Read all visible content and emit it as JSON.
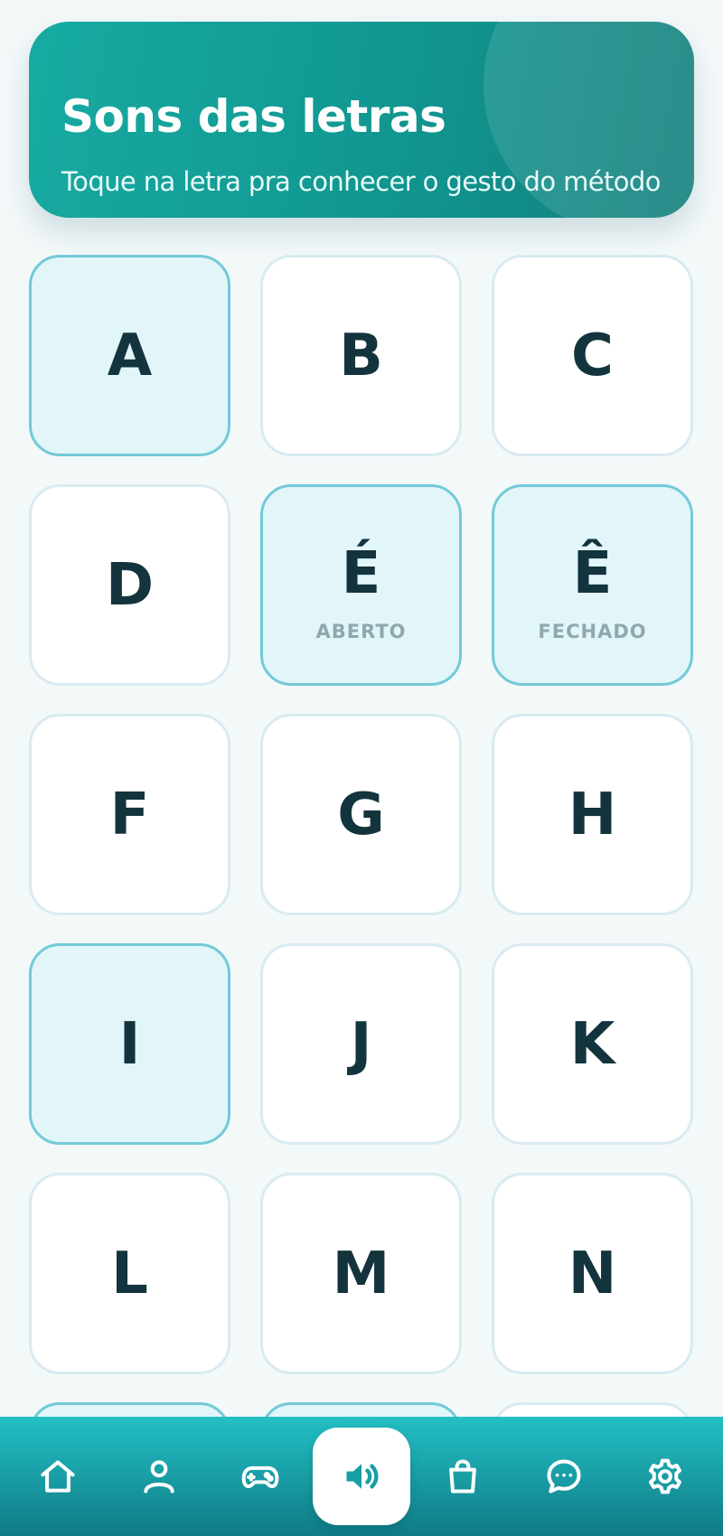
{
  "header": {
    "title": "Sons das letras",
    "subtitle": "Toque na letra pra conhecer o gesto do método"
  },
  "letters": [
    {
      "letter": "A",
      "highlighted": true
    },
    {
      "letter": "B",
      "highlighted": false
    },
    {
      "letter": "C",
      "highlighted": false
    },
    {
      "letter": "D",
      "highlighted": false
    },
    {
      "letter": "É",
      "sub": "ABERTO",
      "highlighted": true
    },
    {
      "letter": "Ê",
      "sub": "FECHADO",
      "highlighted": true
    },
    {
      "letter": "F",
      "highlighted": false
    },
    {
      "letter": "G",
      "highlighted": false
    },
    {
      "letter": "H",
      "highlighted": false
    },
    {
      "letter": "I",
      "highlighted": true
    },
    {
      "letter": "J",
      "highlighted": false
    },
    {
      "letter": "K",
      "highlighted": false
    },
    {
      "letter": "L",
      "highlighted": false
    },
    {
      "letter": "M",
      "highlighted": false
    },
    {
      "letter": "N",
      "highlighted": false
    },
    {
      "letter": "",
      "highlighted": true
    },
    {
      "letter": "",
      "highlighted": true
    },
    {
      "letter": "",
      "highlighted": false
    }
  ],
  "nav": {
    "active": "sounds",
    "items": [
      {
        "icon": "home-icon"
      },
      {
        "icon": "user-icon"
      },
      {
        "icon": "gamepad-icon"
      },
      {
        "icon": "speaker-icon"
      },
      {
        "icon": "bag-icon"
      },
      {
        "icon": "chat-icon"
      },
      {
        "icon": "gear-icon"
      }
    ]
  },
  "colors": {
    "accent": "#17aba2",
    "tile_highlight": "#e2f5f9",
    "tile_highlight_border": "#72cad8",
    "letter": "#13343d"
  }
}
